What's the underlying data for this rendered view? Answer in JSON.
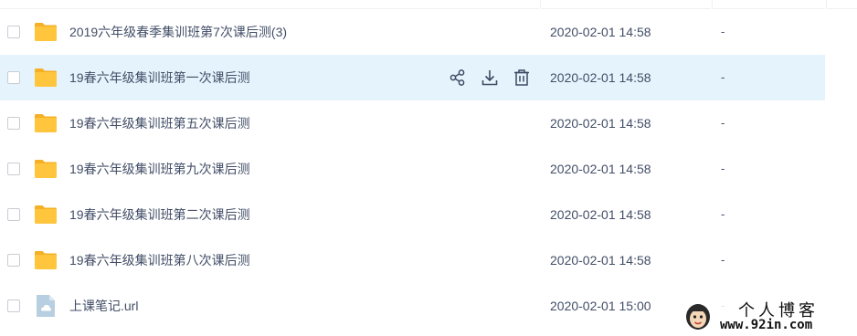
{
  "files": [
    {
      "name": "2019六年级春季集训班第7次课后测(3)",
      "type": "folder",
      "modified": "2020-02-01 14:58",
      "size": "-",
      "hovered": false
    },
    {
      "name": "19春六年级集训班第一次课后测",
      "type": "folder",
      "modified": "2020-02-01 14:58",
      "size": "-",
      "hovered": true
    },
    {
      "name": "19春六年级集训班第五次课后测",
      "type": "folder",
      "modified": "2020-02-01 14:58",
      "size": "-",
      "hovered": false
    },
    {
      "name": "19春六年级集训班第九次课后测",
      "type": "folder",
      "modified": "2020-02-01 14:58",
      "size": "-",
      "hovered": false
    },
    {
      "name": "19春六年级集训班第二次课后测",
      "type": "folder",
      "modified": "2020-02-01 14:58",
      "size": "-",
      "hovered": false
    },
    {
      "name": "19春六年级集训班第八次课后测",
      "type": "folder",
      "modified": "2020-02-01 14:58",
      "size": "-",
      "hovered": false
    },
    {
      "name": "上课笔记.url",
      "type": "url-file",
      "modified": "2020-02-01 15:00",
      "size": "-",
      "hovered": false
    }
  ],
  "row_actions": {
    "share_icon": "share-icon",
    "download_icon": "download-icon",
    "delete_icon": "trash-icon"
  },
  "watermark": {
    "title": "个人博客",
    "url": "www.92in.com"
  },
  "colors": {
    "folder": "#ffc53d",
    "folder_tab": "#f5b026",
    "hover_row": "#e5f4fc",
    "text": "#424e67",
    "icon": "#3d4a63",
    "url_file": "#b7cfe0"
  }
}
